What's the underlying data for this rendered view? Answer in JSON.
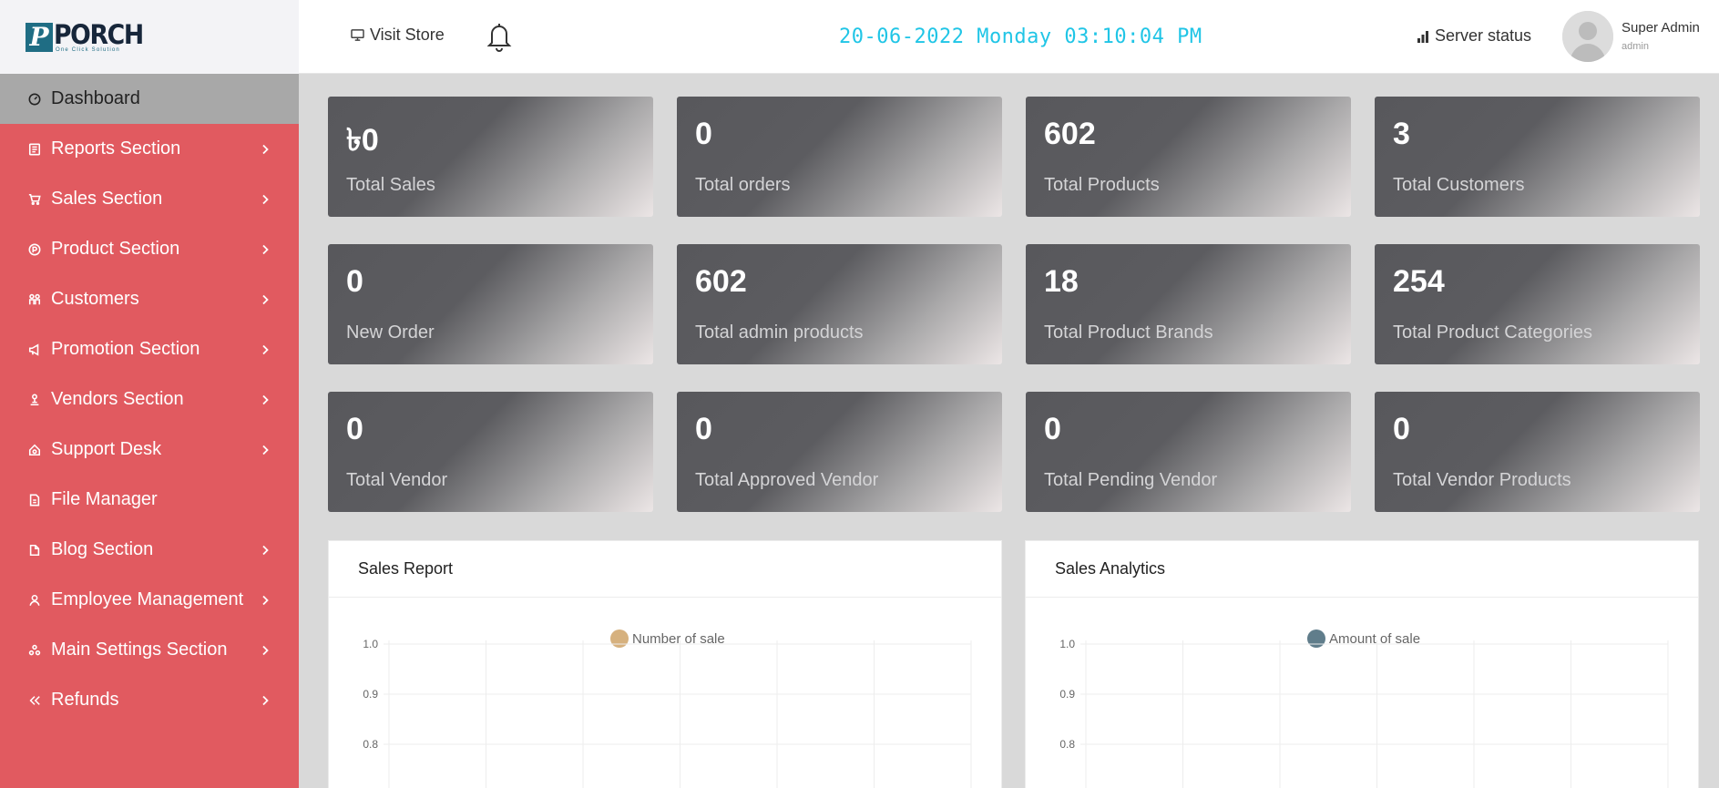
{
  "brand": {
    "logo_text": "PORCH",
    "logo_mark": "P",
    "tagline": "One Click Solution"
  },
  "sidebar": {
    "items": [
      {
        "label": "Dashboard",
        "icon": "gauge-icon",
        "has_children": false,
        "active": true
      },
      {
        "label": "Reports Section",
        "icon": "report-icon",
        "has_children": true
      },
      {
        "label": "Sales Section",
        "icon": "cart-icon",
        "has_children": true
      },
      {
        "label": "Product Section",
        "icon": "product-icon",
        "has_children": true
      },
      {
        "label": "Customers",
        "icon": "customers-icon",
        "has_children": true
      },
      {
        "label": "Promotion Section",
        "icon": "megaphone-icon",
        "has_children": true
      },
      {
        "label": "Vendors Section",
        "icon": "vendor-icon",
        "has_children": true
      },
      {
        "label": "Support Desk",
        "icon": "support-icon",
        "has_children": true
      },
      {
        "label": "File Manager",
        "icon": "file-icon",
        "has_children": false
      },
      {
        "label": "Blog Section",
        "icon": "blog-icon",
        "has_children": true
      },
      {
        "label": "Employee Management",
        "icon": "employee-icon",
        "has_children": true
      },
      {
        "label": "Main Settings Section",
        "icon": "settings-icon",
        "has_children": true
      },
      {
        "label": "Refunds",
        "icon": "refund-icon",
        "has_children": true
      }
    ]
  },
  "topbar": {
    "visit_store": "Visit Store",
    "datetime": "20-06-2022 Monday 03:10:04 PM",
    "server_status": "Server status",
    "user_name": "Super Admin",
    "user_role": "admin"
  },
  "stats": [
    {
      "value": "৳0",
      "label": "Total Sales"
    },
    {
      "value": "0",
      "label": "Total orders"
    },
    {
      "value": "602",
      "label": "Total Products"
    },
    {
      "value": "3",
      "label": "Total Customers"
    },
    {
      "value": "0",
      "label": "New Order"
    },
    {
      "value": "602",
      "label": "Total admin products"
    },
    {
      "value": "18",
      "label": "Total Product Brands"
    },
    {
      "value": "254",
      "label": "Total Product Categories"
    },
    {
      "value": "0",
      "label": "Total Vendor"
    },
    {
      "value": "0",
      "label": "Total Approved Vendor"
    },
    {
      "value": "0",
      "label": "Total Pending Vendor"
    },
    {
      "value": "0",
      "label": "Total Vendor Products"
    }
  ],
  "panels": {
    "sales_report": {
      "title": "Sales Report"
    },
    "sales_analytics": {
      "title": "Sales Analytics"
    }
  },
  "colors": {
    "sidebar_bg": "#e15a60",
    "clock": "#20c5e6",
    "sales_report_series": "#d6b17e",
    "sales_analytics_series": "#607d8b"
  },
  "chart_data": [
    {
      "type": "line",
      "title": "Sales Report",
      "series": [
        {
          "name": "Number of sale",
          "values": []
        }
      ],
      "y_ticks": [
        "1.0",
        "0.9",
        "0.8"
      ],
      "ylim": [
        0.8,
        1.0
      ],
      "grid": true,
      "legend_position": "top"
    },
    {
      "type": "line",
      "title": "Sales Analytics",
      "series": [
        {
          "name": "Amount of sale",
          "values": []
        }
      ],
      "y_ticks": [
        "1.0",
        "0.9",
        "0.8"
      ],
      "ylim": [
        0.8,
        1.0
      ],
      "grid": true,
      "legend_position": "top"
    }
  ]
}
